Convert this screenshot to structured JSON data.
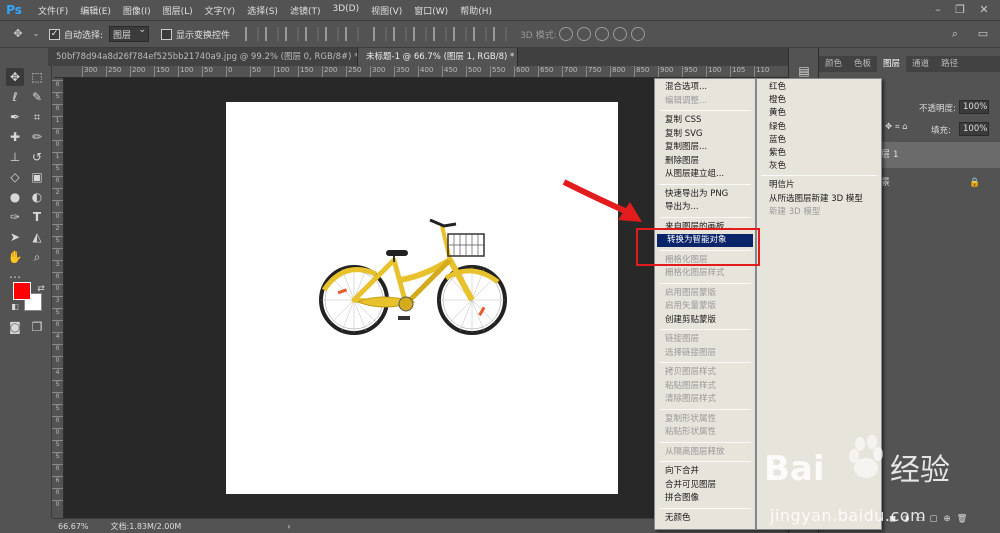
{
  "app": {
    "logo": "Ps",
    "menu": [
      "文件(F)",
      "编辑(E)",
      "图像(I)",
      "图层(L)",
      "文字(Y)",
      "选择(S)",
      "滤镜(T)",
      "3D(D)",
      "视图(V)",
      "窗口(W)",
      "帮助(H)"
    ]
  },
  "options_bar": {
    "auto_select_label": "自动选择:",
    "auto_select_checked": true,
    "auto_select_value": "图层",
    "show_transform_label": "显示变换控件",
    "show_transform_checked": false,
    "mode_3d_label": "3D 模式:"
  },
  "tabs": [
    {
      "label": "50bf78d94a8d26f784ef525bb21740a9.jpg @ 99.2% (图层 0, RGB/8#) *",
      "active": false
    },
    {
      "label": "未标题-1 @ 66.7% (图层 1, RGB/8) *",
      "active": true
    }
  ],
  "ruler_top": [
    "300",
    "250",
    "200",
    "150",
    "100",
    "50",
    "0",
    "50",
    "100",
    "150",
    "200",
    "250",
    "300",
    "350",
    "400",
    "450",
    "500",
    "550",
    "600",
    "650",
    "700",
    "750",
    "800",
    "850",
    "900",
    "950",
    "100",
    "105",
    "110"
  ],
  "ruler_left": [
    "0",
    "5",
    "0",
    "1",
    "0",
    "0",
    "1",
    "5",
    "0",
    "2",
    "0",
    "0",
    "2",
    "5",
    "0",
    "3",
    "0",
    "0",
    "3",
    "5",
    "0",
    "4",
    "0",
    "0",
    "4",
    "5",
    "0",
    "5",
    "0",
    "0",
    "5",
    "5",
    "0",
    "6",
    "0",
    "0"
  ],
  "status": {
    "zoom": "66.67%",
    "doc": "文档:1.83M/2.00M"
  },
  "tools": [
    "move-tool",
    "marquee-tool",
    "lasso-tool",
    "quick-select-tool",
    "eyedropper-tool",
    "crop-tool",
    "healing-tool",
    "brush-tool",
    "clone-stamp-tool",
    "history-brush-tool",
    "eraser-tool",
    "gradient-tool",
    "blur-tool",
    "dodge-tool",
    "pen-tool",
    "type-tool",
    "path-select-tool",
    "shape-tool",
    "hand-tool",
    "zoom-tool"
  ],
  "colors": {
    "foreground": "#ff0000",
    "background": "#ffffff"
  },
  "panel": {
    "tabs": [
      "颜色",
      "色板",
      "图层",
      "通道",
      "路径"
    ],
    "active_tab": "图层",
    "opacity_label": "不透明度:",
    "opacity_value": "100%",
    "fill_label": "填充:",
    "fill_value": "100%",
    "layers": [
      {
        "name": "层 1",
        "selected": true
      },
      {
        "name": "景",
        "selected": false,
        "locked": true
      }
    ]
  },
  "context_menu": {
    "items": [
      {
        "label": "混合选项...",
        "enabled": true
      },
      {
        "label": "编辑调整...",
        "enabled": false
      },
      {
        "sep": true
      },
      {
        "label": "复制 CSS",
        "enabled": true
      },
      {
        "label": "复制 SVG",
        "enabled": true
      },
      {
        "label": "复制图层...",
        "enabled": true
      },
      {
        "label": "删除图层",
        "enabled": true
      },
      {
        "label": "从图层建立组...",
        "enabled": true
      },
      {
        "sep": true
      },
      {
        "label": "快速导出为 PNG",
        "enabled": true
      },
      {
        "label": "导出为...",
        "enabled": true
      },
      {
        "sep": true
      },
      {
        "label": "来自图层的画板...",
        "enabled": true
      },
      {
        "label": "转换为智能对象",
        "enabled": true,
        "highlighted": true
      },
      {
        "sep": true
      },
      {
        "label": "栅格化图层",
        "enabled": false
      },
      {
        "label": "栅格化图层样式",
        "enabled": false
      },
      {
        "sep": true
      },
      {
        "label": "启用图层蒙版",
        "enabled": false
      },
      {
        "label": "启用矢量蒙版",
        "enabled": false
      },
      {
        "label": "创建剪贴蒙版",
        "enabled": true
      },
      {
        "sep": true
      },
      {
        "label": "链接图层",
        "enabled": false
      },
      {
        "label": "选择链接图层",
        "enabled": false
      },
      {
        "sep": true
      },
      {
        "label": "拷贝图层样式",
        "enabled": false
      },
      {
        "label": "粘贴图层样式",
        "enabled": false
      },
      {
        "label": "清除图层样式",
        "enabled": false
      },
      {
        "sep": true
      },
      {
        "label": "复制形状属性",
        "enabled": false
      },
      {
        "label": "粘贴形状属性",
        "enabled": false
      },
      {
        "sep": true
      },
      {
        "label": "从隔离图层释放",
        "enabled": false
      },
      {
        "sep": true
      },
      {
        "label": "向下合并",
        "enabled": true
      },
      {
        "label": "合并可见图层",
        "enabled": true
      },
      {
        "label": "拼合图像",
        "enabled": true
      },
      {
        "sep": true
      },
      {
        "label": "无颜色",
        "enabled": true
      }
    ]
  },
  "sub_menu": {
    "items": [
      {
        "label": "红色",
        "enabled": true
      },
      {
        "label": "橙色",
        "enabled": true
      },
      {
        "label": "黄色",
        "enabled": true
      },
      {
        "label": "绿色",
        "enabled": true
      },
      {
        "label": "蓝色",
        "enabled": true
      },
      {
        "label": "紫色",
        "enabled": true
      },
      {
        "label": "灰色",
        "enabled": true
      },
      {
        "sep": true
      },
      {
        "label": "明信片",
        "enabled": true
      },
      {
        "label": "从所选图层新建 3D 模型",
        "enabled": true
      },
      {
        "label": "新建 3D 模型",
        "enabled": false
      }
    ]
  },
  "watermark": {
    "text": "jingyan.baidu.com",
    "logo_text": "Bai",
    "logo_text2": "经验"
  }
}
